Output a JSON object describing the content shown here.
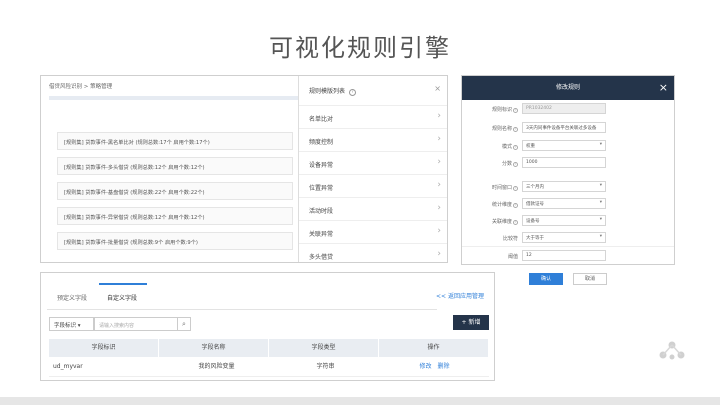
{
  "slide_title": "可视化规则引擎",
  "panel1": {
    "breadcrumb": "借贷风险识别 > 策略管理",
    "rules": [
      "[规则集] 贷款事件-黑名单比对 (规则总数:17个 启用个数:17个)",
      "[规则集] 贷款事件-多头借贷 (规则总数:12个 启用个数:12个)",
      "[规则集] 贷款事件-基盘借贷 (规则总数:22个 启用个数:22个)",
      "[规则集] 贷款事件-异常借贷 (规则总数:12个 启用个数:12个)",
      "[规则集] 贷款事件-批量借贷 (规则总数:9个 启用个数:9个)"
    ],
    "drawer_title": "规则模版列表",
    "drawer_items": [
      "名单比对",
      "频度控制",
      "设备异常",
      "位置异常",
      "活动时段",
      "关联异常",
      "多头借贷"
    ]
  },
  "panel2": {
    "title": "修改规则",
    "fields": [
      {
        "label": "规则标识",
        "value": "PR1032402",
        "type": "disabled"
      },
      {
        "label": "规则名称",
        "value": "3天内同事件设备平台关联过多设备",
        "type": "text"
      },
      {
        "label": "模式",
        "value": "权重",
        "type": "select"
      },
      {
        "label": "分数",
        "value": "1000",
        "type": "text"
      },
      {
        "label": "时间窗口",
        "value": "三个月内",
        "type": "select"
      },
      {
        "label": "统计维度",
        "value": "借款证号",
        "type": "select"
      },
      {
        "label": "关联维度",
        "value": "设备号",
        "type": "select"
      },
      {
        "label": "比较符",
        "value": "大于等于",
        "type": "select"
      },
      {
        "label": "阈值",
        "value": "12",
        "type": "text"
      }
    ],
    "ok_label": "确认",
    "cancel_label": "取消"
  },
  "panel3": {
    "tabs": [
      "预定义字段",
      "自定义字段"
    ],
    "back_link": "<< 返回应用管理",
    "filter_select": "字段标识",
    "search_placeholder": "请输入搜索内容",
    "add_label": "+ 新增",
    "columns": [
      "字段标识",
      "字段名称",
      "字段类型",
      "操作"
    ],
    "rows": [
      {
        "id": "ud_myvar",
        "name": "我的风险变量",
        "type": "字符串",
        "edit": "修改",
        "delete": "删除"
      }
    ]
  },
  "colors": {
    "accent": "#2f7fd8",
    "dark": "#24344a"
  }
}
